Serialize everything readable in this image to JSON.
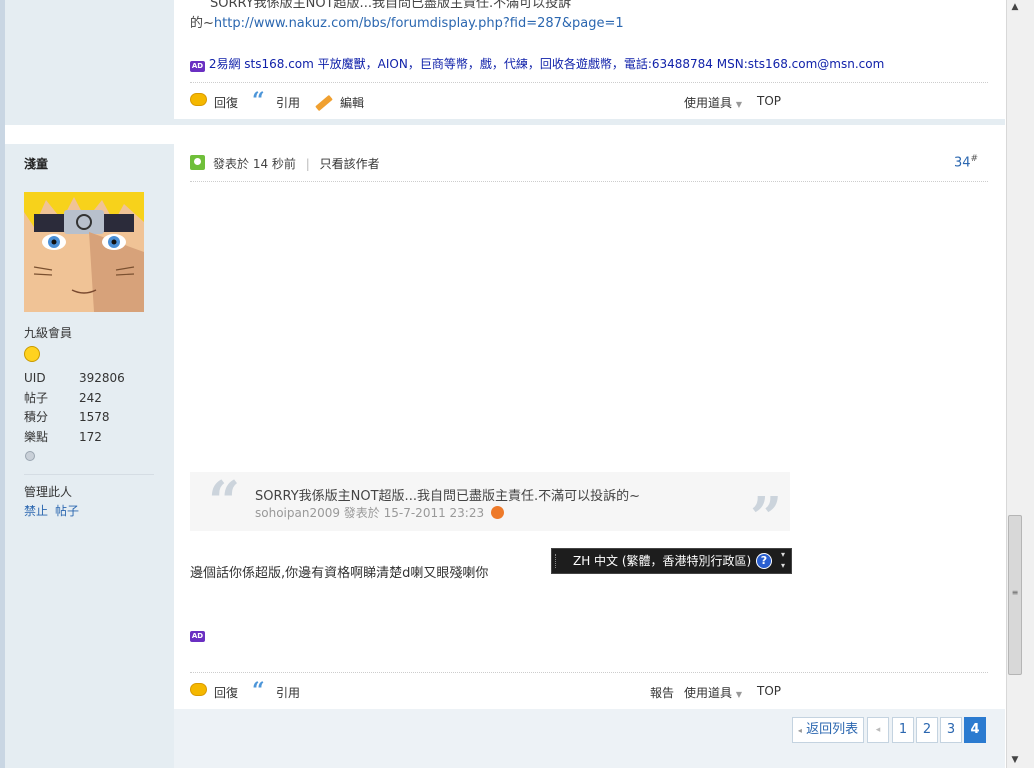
{
  "top_post": {
    "cut_line": "SORRY我係版主NOT超版...我自問已盡版主責任.不滿可以投訴",
    "text_prefix": "的~",
    "link": "http://www.nakuz.com/bbs/forumdisplay.php?fid=287&page=1",
    "ad_text": "2易網 sts168.com 平放魔獸，AION，巨商等幣，戲，代練，回收各遊戲幣，電話:63488784 MSN:sts168.com@msn.com",
    "actions": {
      "reply": "回復",
      "quote": "引用",
      "edit": "編輯",
      "tools": "使用道具",
      "top": "TOP"
    }
  },
  "ad_badge": "AD",
  "user": {
    "name": "淺童",
    "rank": "九級會員",
    "stats": [
      {
        "key": "UID",
        "value": "392806"
      },
      {
        "key": "帖子",
        "value": "242"
      },
      {
        "key": "積分",
        "value": "1578"
      },
      {
        "key": "樂點",
        "value": "172"
      }
    ],
    "admin_label": "管理此人",
    "ban": "禁止",
    "posts": "帖子"
  },
  "post": {
    "posted": "發表於 14 秒前",
    "divider": "|",
    "author_only": "只看該作者",
    "floor": "34",
    "floor_mark": "#",
    "quote_text": "SORRY我係版主NOT超版...我自問已盡版主責任.不滿可以投訴的~",
    "quote_meta": "sohoipan2009 發表於 15-7-2011 23:23",
    "body": "邊個話你係超版,你邊有資格啊睇清楚d喇又眼殘喇你",
    "actions": {
      "reply": "回復",
      "quote": "引用",
      "report": "報告",
      "tools": "使用道具",
      "top": "TOP"
    }
  },
  "lang_bar": {
    "label": "ZH 中文 (繁體，香港特別行政區)",
    "help": "?"
  },
  "pagination": {
    "back": "返回列表",
    "pages": [
      "1",
      "2",
      "3",
      "4"
    ],
    "current": "4"
  }
}
